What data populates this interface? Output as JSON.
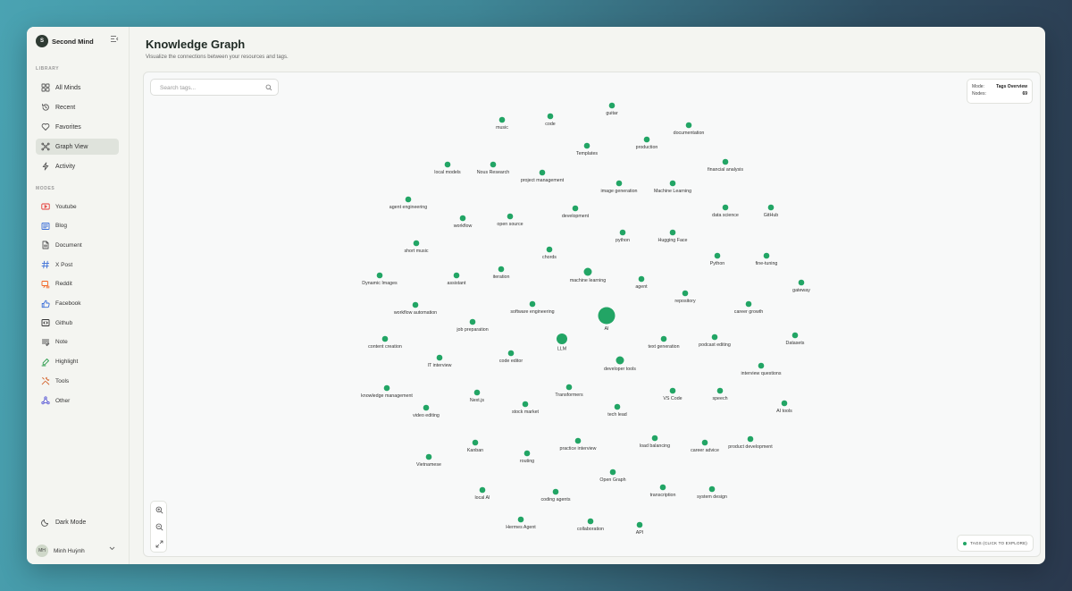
{
  "app": {
    "name": "Second Mind",
    "logo_letter": "S"
  },
  "sidebar": {
    "library_label": "LIBRARY",
    "library_items": [
      {
        "label": "All Minds",
        "icon": "grid-icon",
        "active": false
      },
      {
        "label": "Recent",
        "icon": "history-icon",
        "active": false
      },
      {
        "label": "Favorites",
        "icon": "heart-icon",
        "active": false
      },
      {
        "label": "Graph View",
        "icon": "graph-icon",
        "active": true
      },
      {
        "label": "Activity",
        "icon": "activity-icon",
        "active": false
      }
    ],
    "modes_label": "MODES",
    "mode_items": [
      {
        "label": "Youtube",
        "icon": "youtube-icon",
        "color": "#e53935"
      },
      {
        "label": "Blog",
        "icon": "blog-icon",
        "color": "#3b6fd8"
      },
      {
        "label": "Document",
        "icon": "document-icon",
        "color": "#555555"
      },
      {
        "label": "X Post",
        "icon": "hash-icon",
        "color": "#3b6fd8"
      },
      {
        "label": "Reddit",
        "icon": "reddit-icon",
        "color": "#f26522"
      },
      {
        "label": "Facebook",
        "icon": "thumbs-up-icon",
        "color": "#3b6fd8"
      },
      {
        "label": "Github",
        "icon": "code-icon",
        "color": "#333333"
      },
      {
        "label": "Note",
        "icon": "note-icon",
        "color": "#555555"
      },
      {
        "label": "Highlight",
        "icon": "highlighter-icon",
        "color": "#2e9e4f"
      },
      {
        "label": "Tools",
        "icon": "tools-icon",
        "color": "#d4622a"
      },
      {
        "label": "Other",
        "icon": "network-icon",
        "color": "#5b5bd6"
      }
    ],
    "dark_mode_label": "Dark Mode",
    "user": {
      "initials": "MH",
      "name": "Minh Huỳnh"
    }
  },
  "header": {
    "title": "Knowledge Graph",
    "subtitle": "Visualize the connections between your resources and tags."
  },
  "search": {
    "placeholder": "Search tags...",
    "value": ""
  },
  "mode_card": {
    "mode_label": "Mode:",
    "mode_value": "Tags Overview",
    "nodes_label": "Nodes:",
    "nodes_value": "69"
  },
  "legend": {
    "text": "TAGS (CLICK TO EXPLORE)"
  },
  "colors": {
    "node": "#22a565",
    "label": "#333333"
  },
  "graph": {
    "nodes": [
      {
        "label": "guitar",
        "size": "small"
      },
      {
        "label": "music",
        "size": "small"
      },
      {
        "label": "code",
        "size": "small"
      },
      {
        "label": "documentation",
        "size": "small"
      },
      {
        "label": "production",
        "size": "small"
      },
      {
        "label": "Templates",
        "size": "small"
      },
      {
        "label": "financial analysis",
        "size": "small"
      },
      {
        "label": "local models",
        "size": "small"
      },
      {
        "label": "Nous Research",
        "size": "small"
      },
      {
        "label": "project management",
        "size": "small"
      },
      {
        "label": "image generation",
        "size": "small"
      },
      {
        "label": "Machine Learning",
        "size": "small"
      },
      {
        "label": "agent engineering",
        "size": "small"
      },
      {
        "label": "development",
        "size": "small"
      },
      {
        "label": "data science",
        "size": "small"
      },
      {
        "label": "GitHub",
        "size": "small"
      },
      {
        "label": "workflow",
        "size": "small"
      },
      {
        "label": "open source",
        "size": "small"
      },
      {
        "label": "python",
        "size": "small"
      },
      {
        "label": "Hugging Face",
        "size": "small"
      },
      {
        "label": "short music",
        "size": "small"
      },
      {
        "label": "chords",
        "size": "small"
      },
      {
        "label": "Python",
        "size": "small"
      },
      {
        "label": "fine-tuning",
        "size": "small"
      },
      {
        "label": "Dynamic Images",
        "size": "small"
      },
      {
        "label": "assistant",
        "size": "small"
      },
      {
        "label": "iteration",
        "size": "small"
      },
      {
        "label": "machine learning",
        "size": "medium"
      },
      {
        "label": "agent",
        "size": "small"
      },
      {
        "label": "gateway",
        "size": "small"
      },
      {
        "label": "repository",
        "size": "small"
      },
      {
        "label": "workflow automation",
        "size": "small"
      },
      {
        "label": "software engineering",
        "size": "small"
      },
      {
        "label": "career growth",
        "size": "small"
      },
      {
        "label": "AI",
        "size": "xlarge"
      },
      {
        "label": "job preparation",
        "size": "small"
      },
      {
        "label": "content creation",
        "size": "small"
      },
      {
        "label": "LLM",
        "size": "large"
      },
      {
        "label": "text generation",
        "size": "small"
      },
      {
        "label": "podcast editing",
        "size": "small"
      },
      {
        "label": "Datasets",
        "size": "small"
      },
      {
        "label": "IT interview",
        "size": "small"
      },
      {
        "label": "code editor",
        "size": "small"
      },
      {
        "label": "developer tools",
        "size": "medium"
      },
      {
        "label": "interview questions",
        "size": "small"
      },
      {
        "label": "knowledge management",
        "size": "small"
      },
      {
        "label": "Transformers",
        "size": "small"
      },
      {
        "label": "Next.js",
        "size": "small"
      },
      {
        "label": "VS Code",
        "size": "small"
      },
      {
        "label": "speech",
        "size": "small"
      },
      {
        "label": "video editing",
        "size": "small"
      },
      {
        "label": "stock market",
        "size": "small"
      },
      {
        "label": "tech lead",
        "size": "small"
      },
      {
        "label": "AI tools",
        "size": "small"
      },
      {
        "label": "Kanban",
        "size": "small"
      },
      {
        "label": "practice interview",
        "size": "small"
      },
      {
        "label": "load balancing",
        "size": "small"
      },
      {
        "label": "career advice",
        "size": "small"
      },
      {
        "label": "product development",
        "size": "small"
      },
      {
        "label": "Vietnamese",
        "size": "small"
      },
      {
        "label": "routing",
        "size": "small"
      },
      {
        "label": "Open Graph",
        "size": "small"
      },
      {
        "label": "local AI",
        "size": "small"
      },
      {
        "label": "coding agents",
        "size": "small"
      },
      {
        "label": "transcription",
        "size": "small"
      },
      {
        "label": "system design",
        "size": "small"
      },
      {
        "label": "Hermes Agent",
        "size": "small"
      },
      {
        "label": "collaboration",
        "size": "small"
      },
      {
        "label": "API",
        "size": "small"
      }
    ]
  }
}
